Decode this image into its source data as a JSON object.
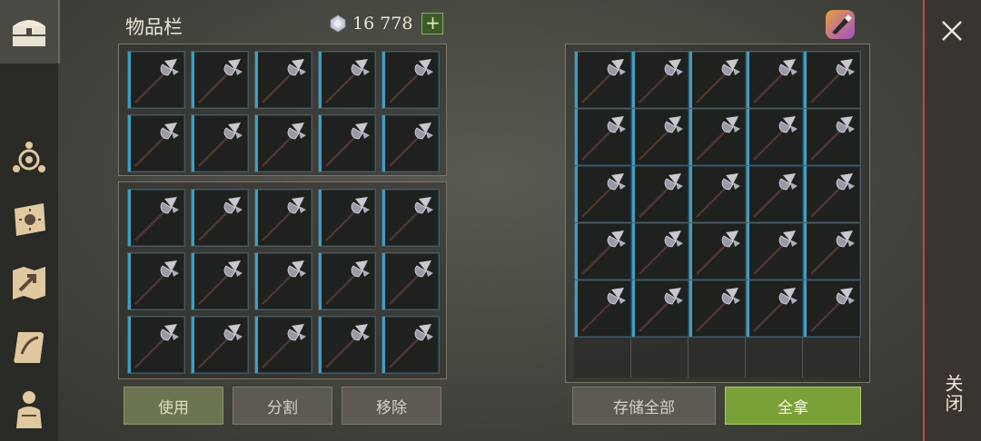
{
  "inventory": {
    "title": "物品栏",
    "currency_value": "16 778",
    "currency_icon": "gem-icon",
    "add_button": "+",
    "actions": {
      "use": "使用",
      "split": "分割",
      "remove": "移除"
    }
  },
  "container": {
    "actions": {
      "store_all": "存储全部",
      "take_all": "全拿"
    }
  },
  "close": {
    "label": "关闭",
    "icon": "close-icon"
  },
  "sidebar": {
    "items": [
      "chest-icon",
      "engram-icon",
      "tribe-book-icon",
      "map-icon",
      "crafting-scroll-icon",
      "character-icon"
    ]
  },
  "item": {
    "icon": "halberd-icon"
  },
  "colors": {
    "slot_accent": "#3aa0c8",
    "take_all_button": "#7aa038",
    "close_border": "#b8503c"
  }
}
